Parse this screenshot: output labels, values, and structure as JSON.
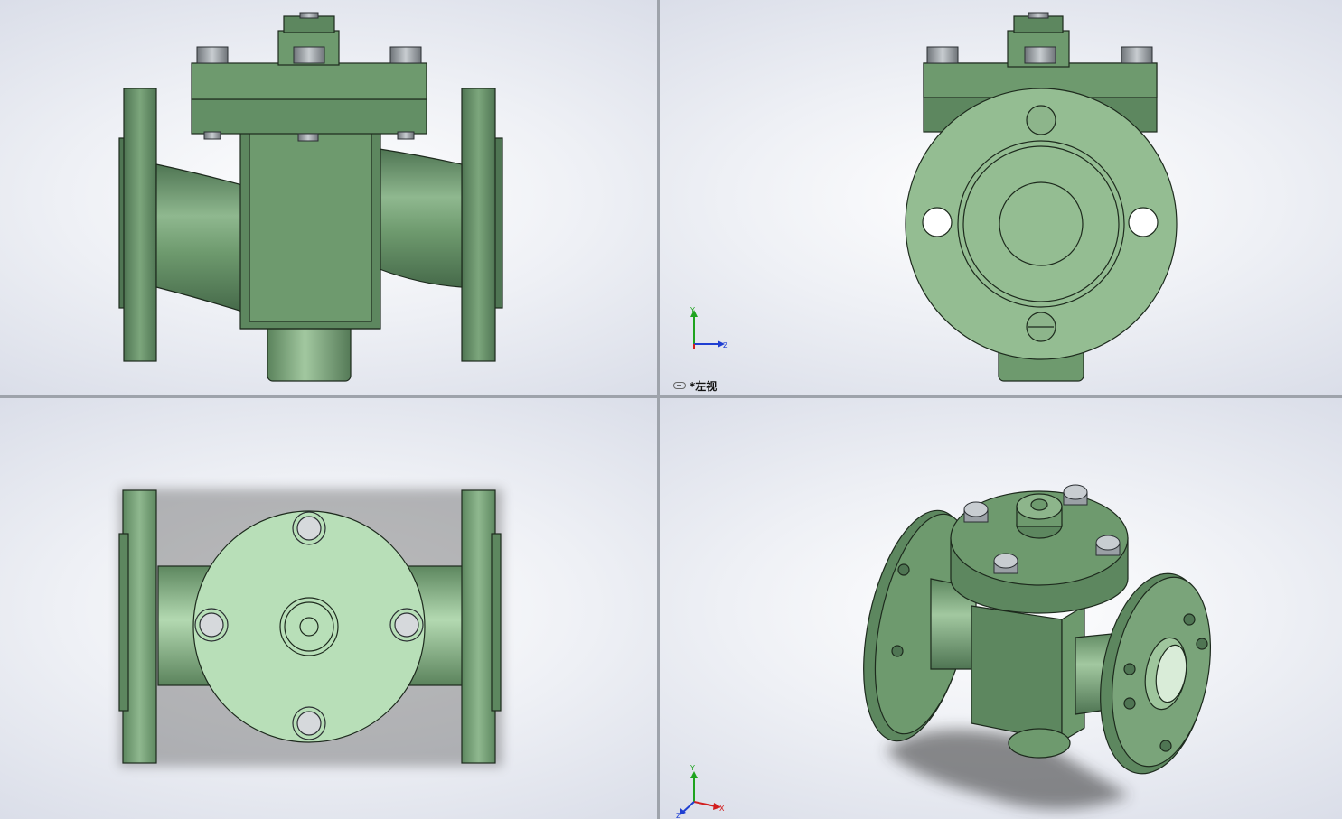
{
  "viewports": {
    "top_left": {
      "view": "front"
    },
    "top_right": {
      "view": "left",
      "label": "*左视",
      "has_triad": true
    },
    "bottom_left": {
      "view": "top"
    },
    "bottom_right": {
      "view": "isometric",
      "has_triad": true
    }
  },
  "triad": {
    "x": "X",
    "y": "Y",
    "z": "Z"
  },
  "colors": {
    "body": "#6e9a6e",
    "body_dark": "#4f7553",
    "body_light": "#a9cfa7",
    "top_face": "#b8dfb8",
    "edge": "#1d2a1d",
    "bolt": "#a7adb2",
    "axis_x": "#d21f1f",
    "axis_y": "#1fa31f",
    "axis_z": "#1f3fd2",
    "splitter": "#9ea3ab"
  },
  "icons": [
    "link-icon",
    "triad-icon"
  ]
}
